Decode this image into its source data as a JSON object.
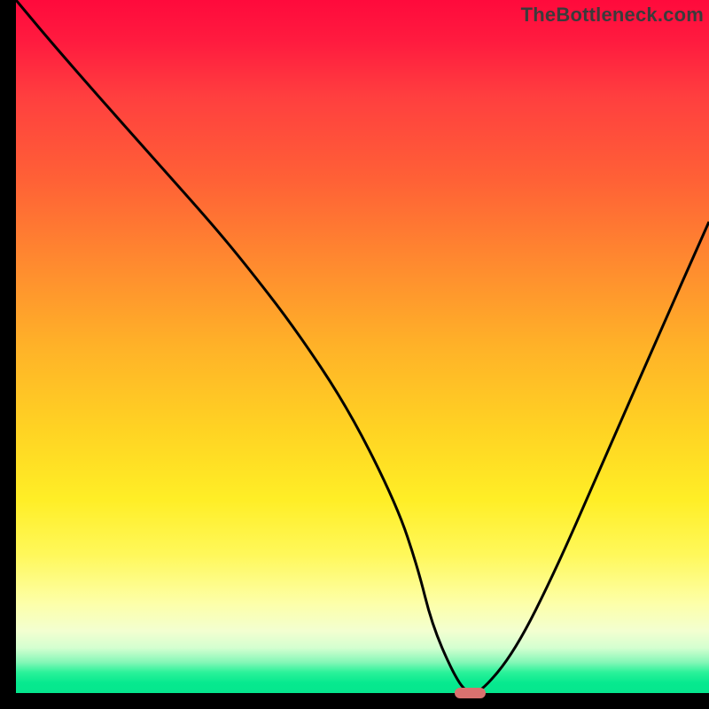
{
  "watermark": "TheBottleneck.com",
  "colors": {
    "frame": "#000000",
    "curve": "#000000",
    "marker": "#d9716f",
    "gradient_top": "#ff0a3c",
    "gradient_bottom": "#05e68d"
  },
  "chart_data": {
    "type": "line",
    "title": "",
    "xlabel": "",
    "ylabel": "",
    "xlim": [
      0,
      100
    ],
    "ylim": [
      0,
      100
    ],
    "series": [
      {
        "name": "bottleneck-curve",
        "x": [
          0,
          5,
          12,
          20,
          28,
          33,
          40,
          48,
          55,
          58,
          60,
          63,
          65,
          67,
          72,
          78,
          85,
          92,
          100
        ],
        "values": [
          100,
          94,
          86,
          77,
          68,
          62,
          53,
          41,
          27,
          18,
          10,
          3,
          0,
          0,
          6,
          18,
          34,
          50,
          68
        ]
      }
    ],
    "marker": {
      "x": 65.5,
      "y": 0,
      "width_frac": 0.045,
      "height_frac": 0.016
    },
    "annotations": []
  }
}
